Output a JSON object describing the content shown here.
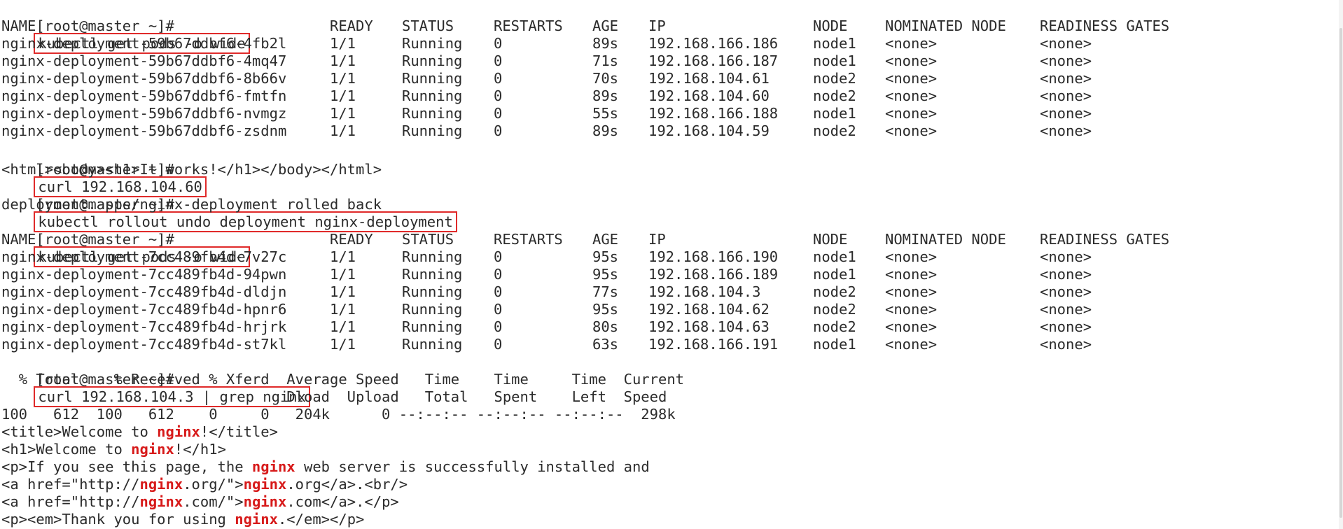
{
  "prompt": "[root@master ~]#",
  "cmd1": "kubectl get pods -o wide",
  "headers": [
    "NAME",
    "READY",
    "STATUS",
    "RESTARTS",
    "AGE",
    "IP",
    "NODE",
    "NOMINATED NODE",
    "READINESS GATES"
  ],
  "pods1": [
    [
      "nginx-deployment-59b67ddbf6-4fb2l",
      "1/1",
      "Running",
      "0",
      "89s",
      "192.168.166.186",
      "node1",
      "<none>",
      "<none>"
    ],
    [
      "nginx-deployment-59b67ddbf6-4mq47",
      "1/1",
      "Running",
      "0",
      "71s",
      "192.168.166.187",
      "node1",
      "<none>",
      "<none>"
    ],
    [
      "nginx-deployment-59b67ddbf6-8b66v",
      "1/1",
      "Running",
      "0",
      "70s",
      "192.168.104.61",
      "node2",
      "<none>",
      "<none>"
    ],
    [
      "nginx-deployment-59b67ddbf6-fmtfn",
      "1/1",
      "Running",
      "0",
      "89s",
      "192.168.104.60",
      "node2",
      "<none>",
      "<none>"
    ],
    [
      "nginx-deployment-59b67ddbf6-nvmgz",
      "1/1",
      "Running",
      "0",
      "55s",
      "192.168.166.188",
      "node1",
      "<none>",
      "<none>"
    ],
    [
      "nginx-deployment-59b67ddbf6-zsdnm",
      "1/1",
      "Running",
      "0",
      "89s",
      "192.168.104.59",
      "node2",
      "<none>",
      "<none>"
    ]
  ],
  "cmd2": "curl 192.168.104.60",
  "out2": "<html><body><h1>It works!</h1></body></html>",
  "cmd3": "kubectl rollout undo deployment nginx-deployment",
  "out3": "deployment.apps/nginx-deployment rolled back",
  "cmd4": "kubectl get pods -o wide",
  "pods2": [
    [
      "nginx-deployment-7cc489fb4d-7v27c",
      "1/1",
      "Running",
      "0",
      "95s",
      "192.168.166.190",
      "node1",
      "<none>",
      "<none>"
    ],
    [
      "nginx-deployment-7cc489fb4d-94pwn",
      "1/1",
      "Running",
      "0",
      "95s",
      "192.168.166.189",
      "node1",
      "<none>",
      "<none>"
    ],
    [
      "nginx-deployment-7cc489fb4d-dldjn",
      "1/1",
      "Running",
      "0",
      "77s",
      "192.168.104.3",
      "node2",
      "<none>",
      "<none>"
    ],
    [
      "nginx-deployment-7cc489fb4d-hpnr6",
      "1/1",
      "Running",
      "0",
      "95s",
      "192.168.104.62",
      "node2",
      "<none>",
      "<none>"
    ],
    [
      "nginx-deployment-7cc489fb4d-hrjrk",
      "1/1",
      "Running",
      "0",
      "80s",
      "192.168.104.63",
      "node2",
      "<none>",
      "<none>"
    ],
    [
      "nginx-deployment-7cc489fb4d-st7kl",
      "1/1",
      "Running",
      "0",
      "63s",
      "192.168.166.191",
      "node1",
      "<none>",
      "<none>"
    ]
  ],
  "cmd5": "curl 192.168.104.3 | grep nginx",
  "curl_progress": [
    "  % Total    % Received % Xferd  Average Speed   Time    Time     Time  Current",
    "                                 Dload  Upload   Total   Spent    Left  Speed",
    "100   612  100   612    0     0   204k      0 --:--:-- --:--:-- --:--:--  298k"
  ],
  "html_lines": [
    [
      "<title>Welcome to ",
      "nginx",
      "!</title>"
    ],
    [
      "<h1>Welcome to ",
      "nginx",
      "!</h1>"
    ],
    [
      "<p>If you see this page, the ",
      "nginx",
      " web server is successfully installed and"
    ],
    [
      "<a href=\"http://",
      "nginx",
      ".org/\">",
      "nginx",
      ".org</a>.<br/>"
    ],
    [
      "<a href=\"http://",
      "nginx",
      ".com/\">",
      "nginx",
      ".com</a>.</p>"
    ],
    [
      "<p><em>Thank you for using ",
      "nginx",
      ".</em></p>"
    ]
  ],
  "highlight_color": "#d71a1a",
  "box_color": "#e02a2a"
}
